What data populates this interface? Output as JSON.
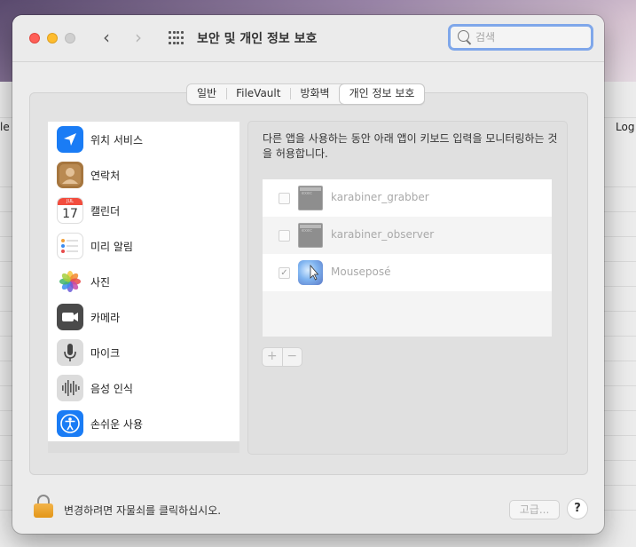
{
  "window": {
    "title": "보안 및 개인 정보 보호"
  },
  "search": {
    "placeholder": "검색"
  },
  "tabs": [
    {
      "label": "일반"
    },
    {
      "label": "FileVault"
    },
    {
      "label": "방화벽"
    },
    {
      "label": "개인 정보 보호",
      "selected": true
    }
  ],
  "sidebar": {
    "items": [
      {
        "label": "위치 서비스",
        "icon": "location-arrow-icon"
      },
      {
        "label": "연락처",
        "icon": "contacts-icon"
      },
      {
        "label": "캘린더",
        "icon": "calendar-icon",
        "icon_month": "JUL",
        "icon_day": "17"
      },
      {
        "label": "미리 알림",
        "icon": "reminders-icon"
      },
      {
        "label": "사진",
        "icon": "photos-icon"
      },
      {
        "label": "카메라",
        "icon": "camera-icon"
      },
      {
        "label": "마이크",
        "icon": "microphone-icon"
      },
      {
        "label": "음성 인식",
        "icon": "speech-recognition-icon"
      },
      {
        "label": "손쉬운 사용",
        "icon": "accessibility-icon"
      }
    ]
  },
  "content": {
    "description": "다른 앱을 사용하는 동안 아래 앱이 키보드 입력을 모니터링하는 것을 허용합니다.",
    "apps": [
      {
        "name": "karabiner_grabber",
        "checked": false,
        "icon": "terminal-icon"
      },
      {
        "name": "karabiner_observer",
        "checked": false,
        "icon": "terminal-icon"
      },
      {
        "name": "Mouseposé",
        "checked": true,
        "icon": "mousepose-icon"
      }
    ],
    "add_label": "+",
    "remove_label": "−"
  },
  "footer": {
    "lock_text": "변경하려면 자물쇠를 클릭하십시오.",
    "advanced_label": "고급...",
    "help_label": "?"
  },
  "background": {
    "left_label": "le",
    "right_label": "Log"
  },
  "colors": {
    "close": "#fe5f57",
    "minimize": "#febc2e",
    "search_focus": "#7fa7ea",
    "lock": "#f0a93b"
  }
}
